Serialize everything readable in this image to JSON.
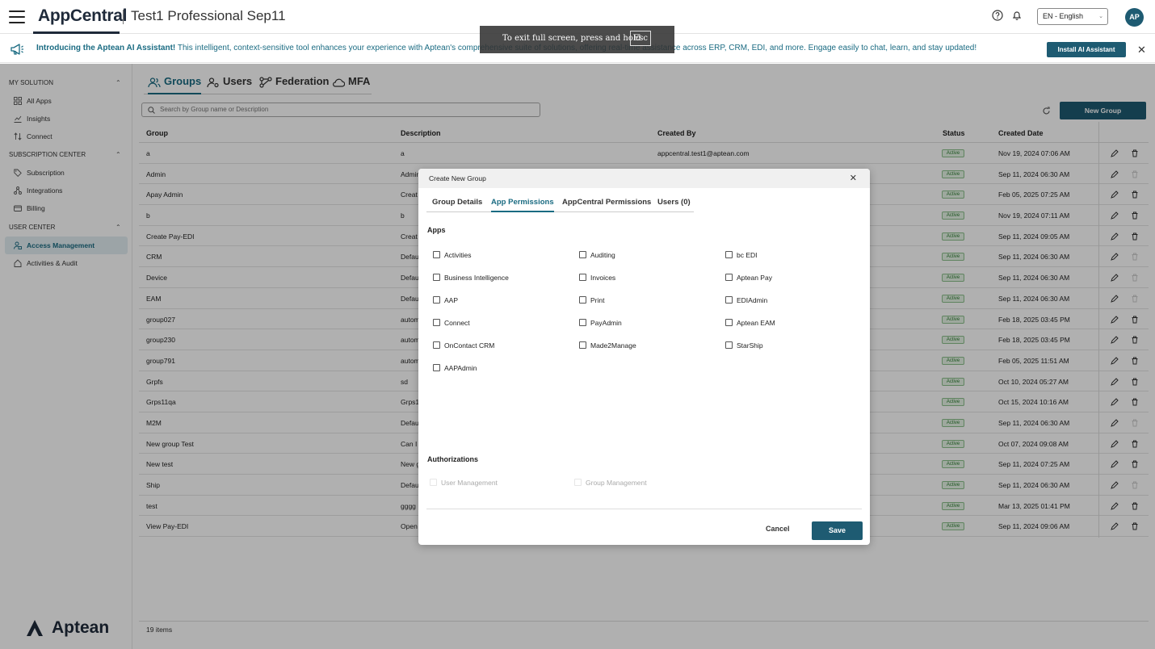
{
  "header": {
    "brand": "AppCentral",
    "tenant": "Test1 Professional Sep11",
    "language": "EN - English",
    "avatar_initials": "AP",
    "accent_color": "#1e5b72"
  },
  "fullscreen_notice": {
    "text": "To exit full screen, press and hold",
    "key": "Esc"
  },
  "banner": {
    "bold": "Introducing the Aptean AI Assistant!",
    "text": " This intelligent, context-sensitive tool enhances your experience with Aptean's comprehensive suite of solutions, offering real-time assistance across ERP, CRM, EDI, and more. Engage easily to chat, learn, and stay updated!",
    "button": "Install AI Assistant"
  },
  "sidebar": {
    "sections": [
      {
        "title": "MY SOLUTION",
        "items": [
          "All Apps",
          "Insights",
          "Connect"
        ]
      },
      {
        "title": "SUBSCRIPTION CENTER",
        "items": [
          "Subscription",
          "Integrations",
          "Billing"
        ]
      },
      {
        "title": "USER CENTER",
        "items": [
          "Access Management",
          "Activities & Audit"
        ]
      }
    ],
    "logo_text": "Aptean"
  },
  "main": {
    "tabs": [
      "Groups",
      "Users",
      "Federation",
      "MFA"
    ],
    "search_placeholder": "Search by Group name or Description",
    "new_group_button": "New Group",
    "columns": [
      "Group",
      "Description",
      "Created By",
      "Status",
      "Created Date"
    ],
    "rows": [
      {
        "group": "a",
        "desc": "a",
        "by": "appcentral.test1@aptean.com",
        "status": "Active",
        "date": "Nov 19, 2024 07:06 AM",
        "del_enabled": true
      },
      {
        "group": "Admin",
        "desc": "Admin",
        "by": "",
        "status": "Active",
        "date": "Sep 11, 2024 06:30 AM",
        "del_enabled": false
      },
      {
        "group": "Apay Admin",
        "desc": "Creat",
        "by": "",
        "status": "Active",
        "date": "Feb 05, 2025 07:25 AM",
        "del_enabled": true
      },
      {
        "group": "b",
        "desc": "b",
        "by": "",
        "status": "Active",
        "date": "Nov 19, 2024 07:11 AM",
        "del_enabled": true
      },
      {
        "group": "Create Pay-EDI",
        "desc": "Creat",
        "by": "",
        "status": "Active",
        "date": "Sep 11, 2024 09:05 AM",
        "del_enabled": true
      },
      {
        "group": "CRM",
        "desc": "Defau",
        "by": "",
        "status": "Active",
        "date": "Sep 11, 2024 06:30 AM",
        "del_enabled": false
      },
      {
        "group": "Device",
        "desc": "Defau",
        "by": "",
        "status": "Active",
        "date": "Sep 11, 2024 06:30 AM",
        "del_enabled": false
      },
      {
        "group": "EAM",
        "desc": "Defau",
        "by": "",
        "status": "Active",
        "date": "Sep 11, 2024 06:30 AM",
        "del_enabled": false
      },
      {
        "group": "group027",
        "desc": "autom",
        "by": "",
        "status": "Active",
        "date": "Feb 18, 2025 03:45 PM",
        "del_enabled": true
      },
      {
        "group": "group230",
        "desc": "autom",
        "by": "",
        "status": "Active",
        "date": "Feb 18, 2025 03:45 PM",
        "del_enabled": true
      },
      {
        "group": "group791",
        "desc": "autom",
        "by": "",
        "status": "Active",
        "date": "Feb 05, 2025 11:51 AM",
        "del_enabled": true
      },
      {
        "group": "Grpfs",
        "desc": "sd",
        "by": "",
        "status": "Active",
        "date": "Oct 10, 2024 05:27 AM",
        "del_enabled": true
      },
      {
        "group": "Grps11qa",
        "desc": "Grps1",
        "by": "",
        "status": "Active",
        "date": "Oct 15, 2024 10:16 AM",
        "del_enabled": true
      },
      {
        "group": "M2M",
        "desc": "Defau",
        "by": "",
        "status": "Active",
        "date": "Sep 11, 2024 06:30 AM",
        "del_enabled": false
      },
      {
        "group": "New group Test",
        "desc": "Can I",
        "by": "",
        "status": "Active",
        "date": "Oct 07, 2024 09:08 AM",
        "del_enabled": true
      },
      {
        "group": "New test",
        "desc": "New g",
        "by": "",
        "status": "Active",
        "date": "Sep 11, 2024 07:25 AM",
        "del_enabled": true
      },
      {
        "group": "Ship",
        "desc": "Defau",
        "by": "",
        "status": "Active",
        "date": "Sep 11, 2024 06:30 AM",
        "del_enabled": false
      },
      {
        "group": "test",
        "desc": "gggg",
        "by": "",
        "status": "Active",
        "date": "Mar 13, 2025 01:41 PM",
        "del_enabled": true
      },
      {
        "group": "View Pay-EDI",
        "desc": "Open",
        "by": "",
        "status": "Active",
        "date": "Sep 11, 2024 09:06 AM",
        "del_enabled": true
      }
    ],
    "item_count": "19 items"
  },
  "modal": {
    "title": "Create New Group",
    "tabs": [
      "Group Details",
      "App Permissions",
      "AppCentral Permissions",
      "Users (0)"
    ],
    "active_tab": "App Permissions",
    "apps_heading": "Apps",
    "apps_columns": [
      [
        "Activities",
        "Business Intelligence",
        "AAP",
        "Connect",
        "OnContact CRM",
        "AAPAdmin"
      ],
      [
        "Auditing",
        "Invoices",
        "Print",
        "PayAdmin",
        "Made2Manage"
      ],
      [
        "bc EDI",
        "Aptean Pay",
        "EDIAdmin",
        "Aptean EAM",
        "StarShip"
      ]
    ],
    "auth_heading": "Authorizations",
    "authorizations": [
      "User Management",
      "Group Management"
    ],
    "cancel": "Cancel",
    "save": "Save"
  }
}
